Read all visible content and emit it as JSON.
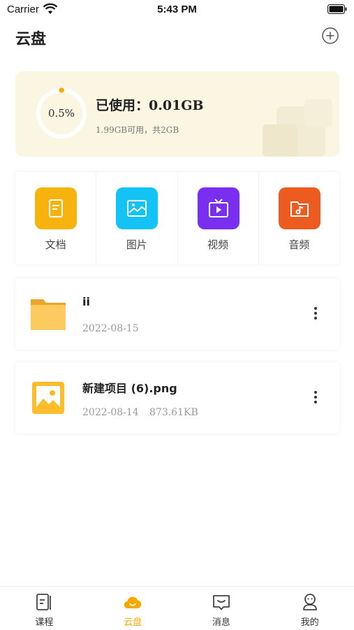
{
  "status_bar": {
    "carrier": "Carrier",
    "time": "5:43 PM"
  },
  "header": {
    "title": "云盘",
    "add_icon": "plus-circle-icon"
  },
  "storage": {
    "percent_label": "0.5%",
    "used_fraction": 0.005,
    "used_label": "已使用：",
    "used_value": "0.01GB",
    "available_text": "1.99GB可用，共2GB",
    "ring_color": "#f6a800",
    "card_color": "#fbf6e2"
  },
  "categories": [
    {
      "label": "文档",
      "icon": "document-icon",
      "color": "#f6b30d"
    },
    {
      "label": "图片",
      "icon": "image-icon",
      "color": "#14c3f5"
    },
    {
      "label": "视频",
      "icon": "video-icon",
      "color": "#7a2ff0"
    },
    {
      "label": "音频",
      "icon": "audio-folder-icon",
      "color": "#ee5b1f"
    }
  ],
  "files": [
    {
      "name": "ii",
      "date": "2022-08-15",
      "size": "",
      "icon": "folder-icon"
    },
    {
      "name": "新建项目 (6).png",
      "date": "2022-08-14",
      "size": "873.61KB",
      "icon": "image-file-icon"
    }
  ],
  "tabbar": {
    "active_color": "#f6a800",
    "items": [
      {
        "label": "课程",
        "icon": "course-icon"
      },
      {
        "label": "云盘",
        "icon": "cloud-icon"
      },
      {
        "label": "消息",
        "icon": "message-icon"
      },
      {
        "label": "我的",
        "icon": "profile-icon"
      }
    ]
  }
}
